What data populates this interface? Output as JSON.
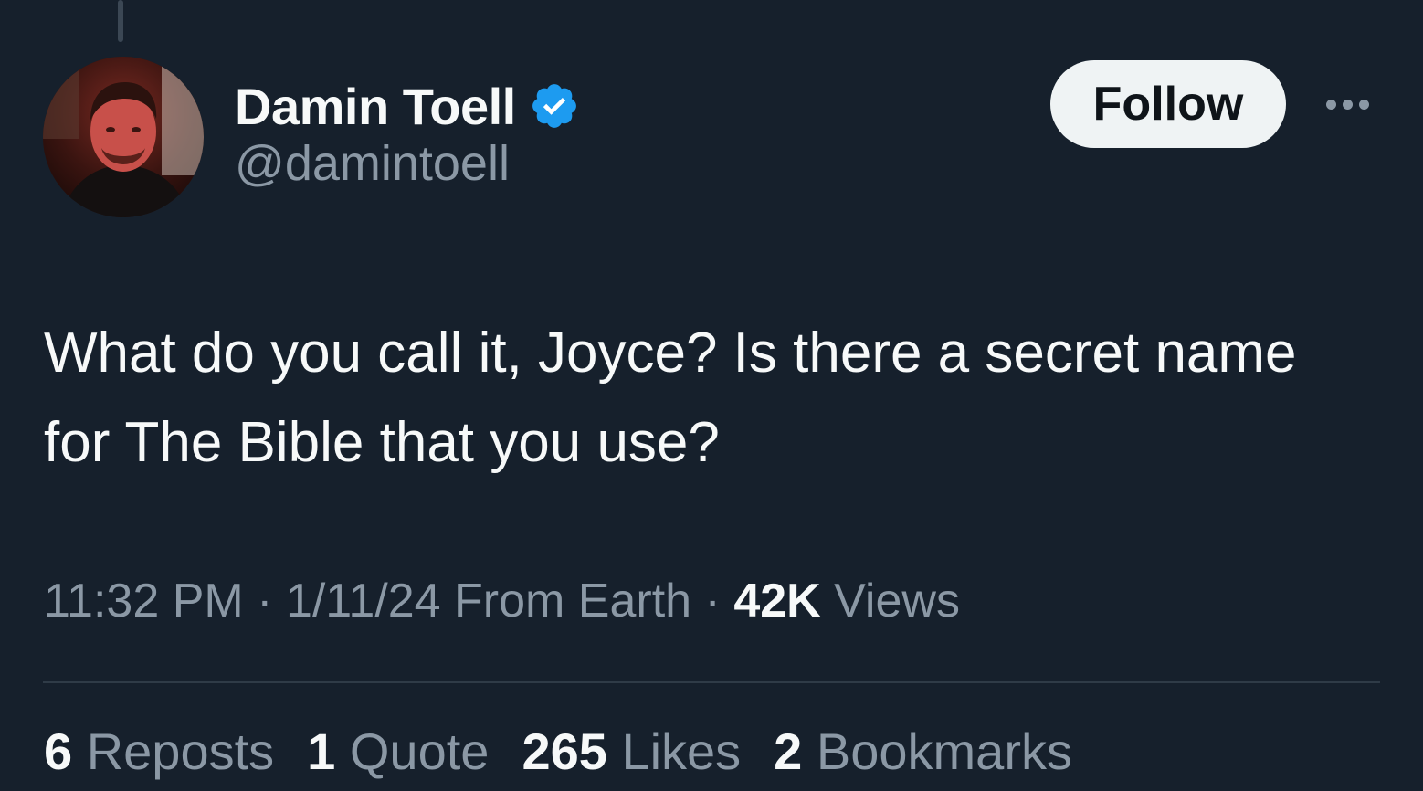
{
  "author": {
    "display_name": "Damin Toell",
    "handle": "@damintoell",
    "verified": true
  },
  "actions": {
    "follow_label": "Follow"
  },
  "tweet": {
    "text": "What do you call it, Joyce? Is there a secret name for The Bible that you use?",
    "time": "11:32 PM",
    "date": "1/11/24",
    "source": "From Earth",
    "views_count": "42K",
    "views_label": "Views"
  },
  "stats": {
    "reposts": {
      "count": "6",
      "label": "Reposts"
    },
    "quotes": {
      "count": "1",
      "label": "Quote"
    },
    "likes": {
      "count": "265",
      "label": "Likes"
    },
    "bookmarks": {
      "count": "2",
      "label": "Bookmarks"
    }
  },
  "colors": {
    "background": "#16202c",
    "verified_badge": "#1d9bf0",
    "muted_text": "#8b98a5",
    "primary_text": "#f7f9f9"
  }
}
